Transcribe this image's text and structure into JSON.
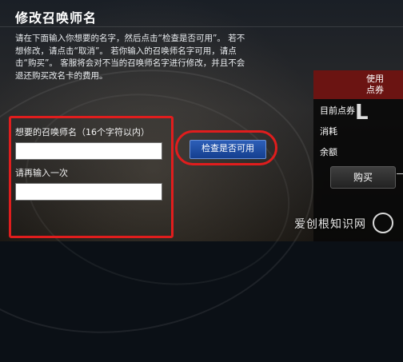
{
  "dialog": {
    "title": "修改召唤师名",
    "description_lines": [
      "请在下面输入你想要的名字，然后点击“检查是否可用”。 若不",
      "想修改，请点击“取消”。 若你输入的召唤师名字可用，请点",
      "击“购买”。 客服将会对不当的召唤师名字进行修改，并且不会",
      "退还购买改名卡的费用。"
    ]
  },
  "form": {
    "name_label": "想要的召唤师名（16个字符以内）",
    "name_value": "",
    "confirm_label": "请再输入一次",
    "confirm_value": "",
    "check_button": "检查是否可用"
  },
  "payment_panel": {
    "header_line1": "使用",
    "header_line2": "点券",
    "current_points_label": "目前点券",
    "cost_label": "消耗",
    "balance_label": "余额",
    "buy_button": "购买"
  },
  "watermark": "爱创根知识网",
  "colors": {
    "highlight_red": "#e01d1d",
    "check_button_blue": "#1f4fa5",
    "panel_header_red": "#6b1412"
  }
}
